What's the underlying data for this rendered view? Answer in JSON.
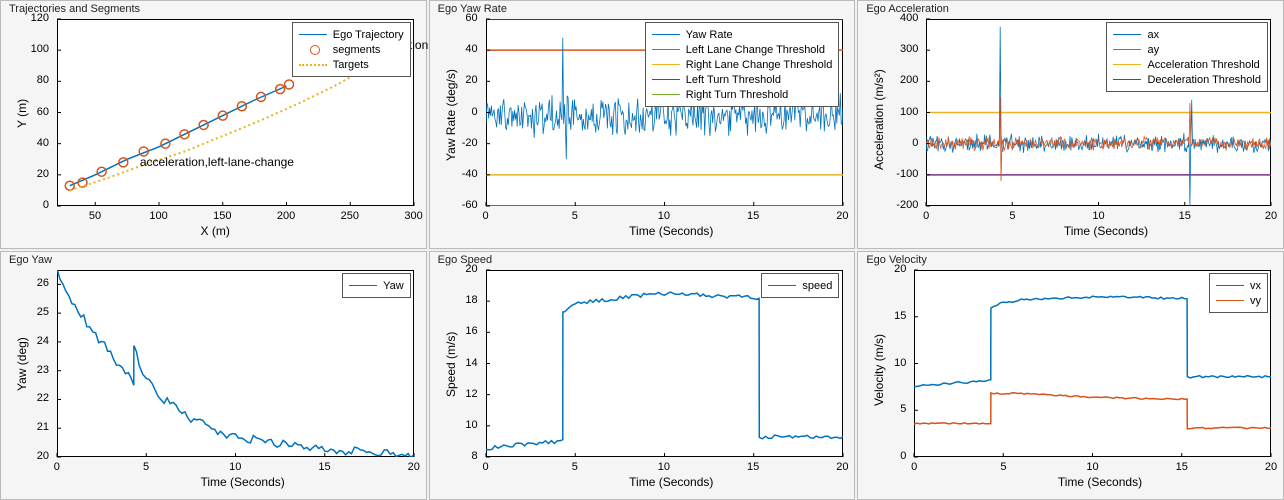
{
  "colors": {
    "c1": "#0072BD",
    "c2": "#D95319",
    "c3": "#EDB120",
    "c4": "#7E2F8E",
    "c5": "#77AC30"
  },
  "chart_data": [
    {
      "id": "trajseg",
      "type": "line",
      "title": "Trajectories and Segments",
      "xlabel": "X (m)",
      "ylabel": "Y (m)",
      "xlim": [
        20,
        300
      ],
      "ylim": [
        0,
        120
      ],
      "xticks": [
        50,
        100,
        150,
        200,
        250,
        300
      ],
      "yticks": [
        0,
        20,
        40,
        60,
        80,
        100,
        120
      ],
      "annotation": "acceleration,left-lane-change",
      "annotation_at": [
        85,
        28
      ],
      "legend_pos": "ne",
      "legend": [
        {
          "name": "Ego Trajectory",
          "style": "line",
          "color": "c1"
        },
        {
          "name": "segments",
          "style": "marker",
          "color": "c2"
        },
        {
          "name": "Targets",
          "style": "dotted",
          "color": "c3"
        }
      ],
      "series": [
        {
          "name": "Ego Trajectory",
          "style": "line",
          "color": "c1",
          "x": [
            30,
            50,
            75,
            100,
            125,
            150,
            175,
            200
          ],
          "y": [
            13,
            20,
            30,
            38,
            48,
            58,
            68,
            77
          ]
        },
        {
          "name": "segments",
          "style": "marker",
          "color": "c2",
          "x": [
            30,
            40,
            55,
            72,
            88,
            105,
            120,
            135,
            150,
            165,
            180,
            195,
            202
          ],
          "y": [
            13,
            15,
            22,
            28,
            35,
            40,
            46,
            52,
            58,
            64,
            70,
            75,
            78
          ]
        },
        {
          "name": "Targets",
          "style": "dotted",
          "color": "c3",
          "x": [
            30,
            60,
            90,
            120,
            150,
            180,
            210,
            240,
            270,
            290
          ],
          "y": [
            10,
            18,
            27,
            35,
            45,
            55,
            66,
            78,
            92,
            108
          ]
        }
      ],
      "extra_text": [
        {
          "text": "tion",
          "at": [
            296,
            103
          ]
        }
      ]
    },
    {
      "id": "yawrate",
      "type": "line",
      "title": "Ego Yaw Rate",
      "xlabel": "Time (Seconds)",
      "ylabel": "Yaw Rate (deg/s)",
      "xlim": [
        0,
        20
      ],
      "ylim": [
        -60,
        60
      ],
      "xticks": [
        0,
        5,
        10,
        15,
        20
      ],
      "yticks": [
        -60,
        -40,
        -20,
        0,
        20,
        40,
        60
      ],
      "legend_pos": "ne",
      "legend": [
        {
          "name": "Yaw Rate",
          "style": "line",
          "color": "c1"
        },
        {
          "name": "Left Lane Change Threshold",
          "style": "line",
          "color": "c2"
        },
        {
          "name": "Right Lane Change Threshold",
          "style": "line",
          "color": "c3"
        },
        {
          "name": "Left Turn Threshold",
          "style": "line",
          "color": "c4"
        },
        {
          "name": "Right Turn Threshold",
          "style": "line",
          "color": "c5"
        }
      ],
      "hlines": [
        {
          "y": 40,
          "color": "c2"
        },
        {
          "y": -40,
          "color": "c3"
        },
        {
          "y": 60,
          "color": "c4"
        },
        {
          "y": -60,
          "color": "c5"
        }
      ],
      "noise": {
        "center": -2,
        "amplitude": 15,
        "color": "c1",
        "spikes": [
          {
            "t": 4.3,
            "v": 48
          },
          {
            "t": 4.5,
            "v": -30
          }
        ]
      }
    },
    {
      "id": "accel",
      "type": "line",
      "title": "Ego Acceleration",
      "xlabel": "Time (Seconds)",
      "ylabel": "Acceleration (m/s²)",
      "ylabel_raw": "Acceleration (m/s^2)",
      "xlim": [
        0,
        20
      ],
      "ylim": [
        -200,
        400
      ],
      "xticks": [
        0,
        5,
        10,
        15,
        20
      ],
      "yticks": [
        -200,
        -100,
        0,
        100,
        200,
        300,
        400
      ],
      "legend_pos": "ne",
      "legend": [
        {
          "name": "ax",
          "style": "line",
          "color": "c1"
        },
        {
          "name": "ay",
          "style": "line",
          "color": "c2"
        },
        {
          "name": "Acceleration Threshold",
          "style": "line",
          "color": "c3"
        },
        {
          "name": "Deceleration Threshold",
          "style": "line",
          "color": "c4"
        }
      ],
      "hlines": [
        {
          "y": 100,
          "color": "c3"
        },
        {
          "y": -100,
          "color": "c4"
        }
      ],
      "noise_multi": [
        {
          "center": 0,
          "amplitude": 35,
          "color": "c1",
          "spikes": [
            {
              "t": 4.3,
              "v": 375
            },
            {
              "t": 15.3,
              "v": -200
            },
            {
              "t": 15.4,
              "v": 140
            }
          ]
        },
        {
          "center": 0,
          "amplitude": 25,
          "color": "c2",
          "spikes": [
            {
              "t": 4.3,
              "v": 150
            },
            {
              "t": 4.35,
              "v": -120
            },
            {
              "t": 15.3,
              "v": 130
            }
          ]
        }
      ]
    },
    {
      "id": "yaw",
      "type": "line",
      "title": "Ego Yaw",
      "xlabel": "Time (Seconds)",
      "ylabel": "Yaw (deg)",
      "xlim": [
        0,
        20
      ],
      "ylim": [
        20,
        26.5
      ],
      "xticks": [
        0,
        5,
        10,
        15,
        20
      ],
      "yticks": [
        20,
        21,
        22,
        23,
        24,
        25,
        26
      ],
      "legend_pos": "ne",
      "legend": [
        {
          "name": "Yaw",
          "style": "line",
          "color": "c1"
        }
      ],
      "series": [
        {
          "name": "Yaw",
          "style": "line",
          "color": "c1",
          "x": [
            0,
            0.5,
            1,
            1.5,
            2,
            2.5,
            3,
            3.5,
            4,
            4.3,
            4.31,
            4.6,
            5,
            6,
            7,
            8,
            9,
            10,
            11,
            12,
            13,
            14,
            15,
            16,
            17,
            18,
            19,
            20
          ],
          "y": [
            26.4,
            25.8,
            25.2,
            24.8,
            24.3,
            24.0,
            23.6,
            23.2,
            22.8,
            22.5,
            23.8,
            23.3,
            22.7,
            22.0,
            21.5,
            21.2,
            20.9,
            20.7,
            20.6,
            20.5,
            20.4,
            20.3,
            20.3,
            20.2,
            20.2,
            20.1,
            20.1,
            20.1
          ],
          "jitter": 0.15
        }
      ]
    },
    {
      "id": "speed",
      "type": "line",
      "title": "Ego Speed",
      "xlabel": "Time (Seconds)",
      "ylabel": "Speed (m/s)",
      "xlim": [
        0,
        20
      ],
      "ylim": [
        8,
        20
      ],
      "xticks": [
        0,
        5,
        10,
        15,
        20
      ],
      "yticks": [
        8,
        10,
        12,
        14,
        16,
        18,
        20
      ],
      "legend_pos": "ne",
      "legend": [
        {
          "name": "speed",
          "style": "line",
          "color": "c1"
        }
      ],
      "series": [
        {
          "name": "speed",
          "style": "line",
          "color": "c1",
          "x": [
            0,
            1,
            2,
            3,
            4,
            4.3,
            4.31,
            4.5,
            5,
            6,
            7,
            8,
            9,
            10,
            11,
            12,
            13,
            14,
            15,
            15.3,
            15.31,
            16,
            17,
            18,
            19,
            20
          ],
          "y": [
            8.5,
            8.7,
            8.8,
            8.9,
            9.0,
            9.1,
            17.2,
            17.5,
            17.8,
            18.0,
            18.1,
            18.3,
            18.4,
            18.5,
            18.4,
            18.4,
            18.3,
            18.3,
            18.2,
            18.2,
            9.2,
            9.3,
            9.3,
            9.3,
            9.3,
            9.3
          ],
          "jitter": 0.12
        }
      ]
    },
    {
      "id": "velocity",
      "type": "line",
      "title": "Ego Velocity",
      "xlabel": "Time (Seconds)",
      "ylabel": "Velocity (m/s)",
      "xlim": [
        0,
        20
      ],
      "ylim": [
        0,
        20
      ],
      "xticks": [
        0,
        5,
        10,
        15,
        20
      ],
      "yticks": [
        0,
        5,
        10,
        15,
        20
      ],
      "legend_pos": "ne",
      "legend": [
        {
          "name": "vx",
          "style": "line",
          "color": "c1"
        },
        {
          "name": "vy",
          "style": "line",
          "color": "c2"
        }
      ],
      "series": [
        {
          "name": "vx",
          "style": "line",
          "color": "c1",
          "x": [
            0,
            1,
            2,
            3,
            4,
            4.3,
            4.31,
            5,
            6,
            8,
            10,
            12,
            14,
            15,
            15.3,
            15.31,
            16,
            18,
            20
          ],
          "y": [
            7.5,
            7.7,
            7.9,
            8.0,
            8.2,
            8.3,
            16.0,
            16.5,
            16.8,
            17.0,
            17.1,
            17.1,
            17.0,
            17.0,
            17.0,
            8.5,
            8.6,
            8.6,
            8.6
          ],
          "jitter": 0.12
        },
        {
          "name": "vy",
          "style": "line",
          "color": "c2",
          "x": [
            0,
            1,
            2,
            3,
            4,
            4.3,
            4.31,
            5,
            6,
            8,
            10,
            12,
            14,
            15,
            15.3,
            15.31,
            16,
            18,
            20
          ],
          "y": [
            3.6,
            3.6,
            3.6,
            3.6,
            3.6,
            3.6,
            6.8,
            6.8,
            6.8,
            6.6,
            6.4,
            6.3,
            6.2,
            6.2,
            6.2,
            3.1,
            3.1,
            3.1,
            3.1
          ],
          "jitter": 0.08
        }
      ]
    }
  ]
}
